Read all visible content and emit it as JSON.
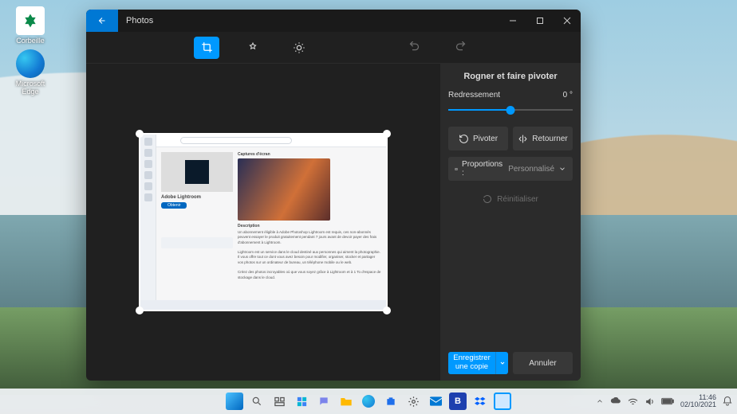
{
  "desktop": {
    "icons": [
      {
        "label": "Corbeille"
      },
      {
        "label": "Microsoft Edge"
      }
    ]
  },
  "window": {
    "title": "Photos",
    "toolbar": {
      "crop_active": true
    },
    "sidepanel": {
      "title": "Rogner et faire pivoter",
      "straighten_label": "Redressement",
      "straighten_value": "0 °",
      "rotate_label": "Pivoter",
      "flip_label": "Retourner",
      "aspect_label": "Proportions :",
      "aspect_value": "Personnalisé",
      "reset_label": "Réinitialiser",
      "save_label": "Enregistrer une copie",
      "cancel_label": "Annuler"
    },
    "canvas_content": {
      "app_title": "Adobe Lightroom",
      "button": "Obtenir",
      "section1": "Captures d'écran",
      "section2": "Description"
    }
  },
  "taskbar": {
    "time": "11:46",
    "date": "02/10/2021"
  }
}
